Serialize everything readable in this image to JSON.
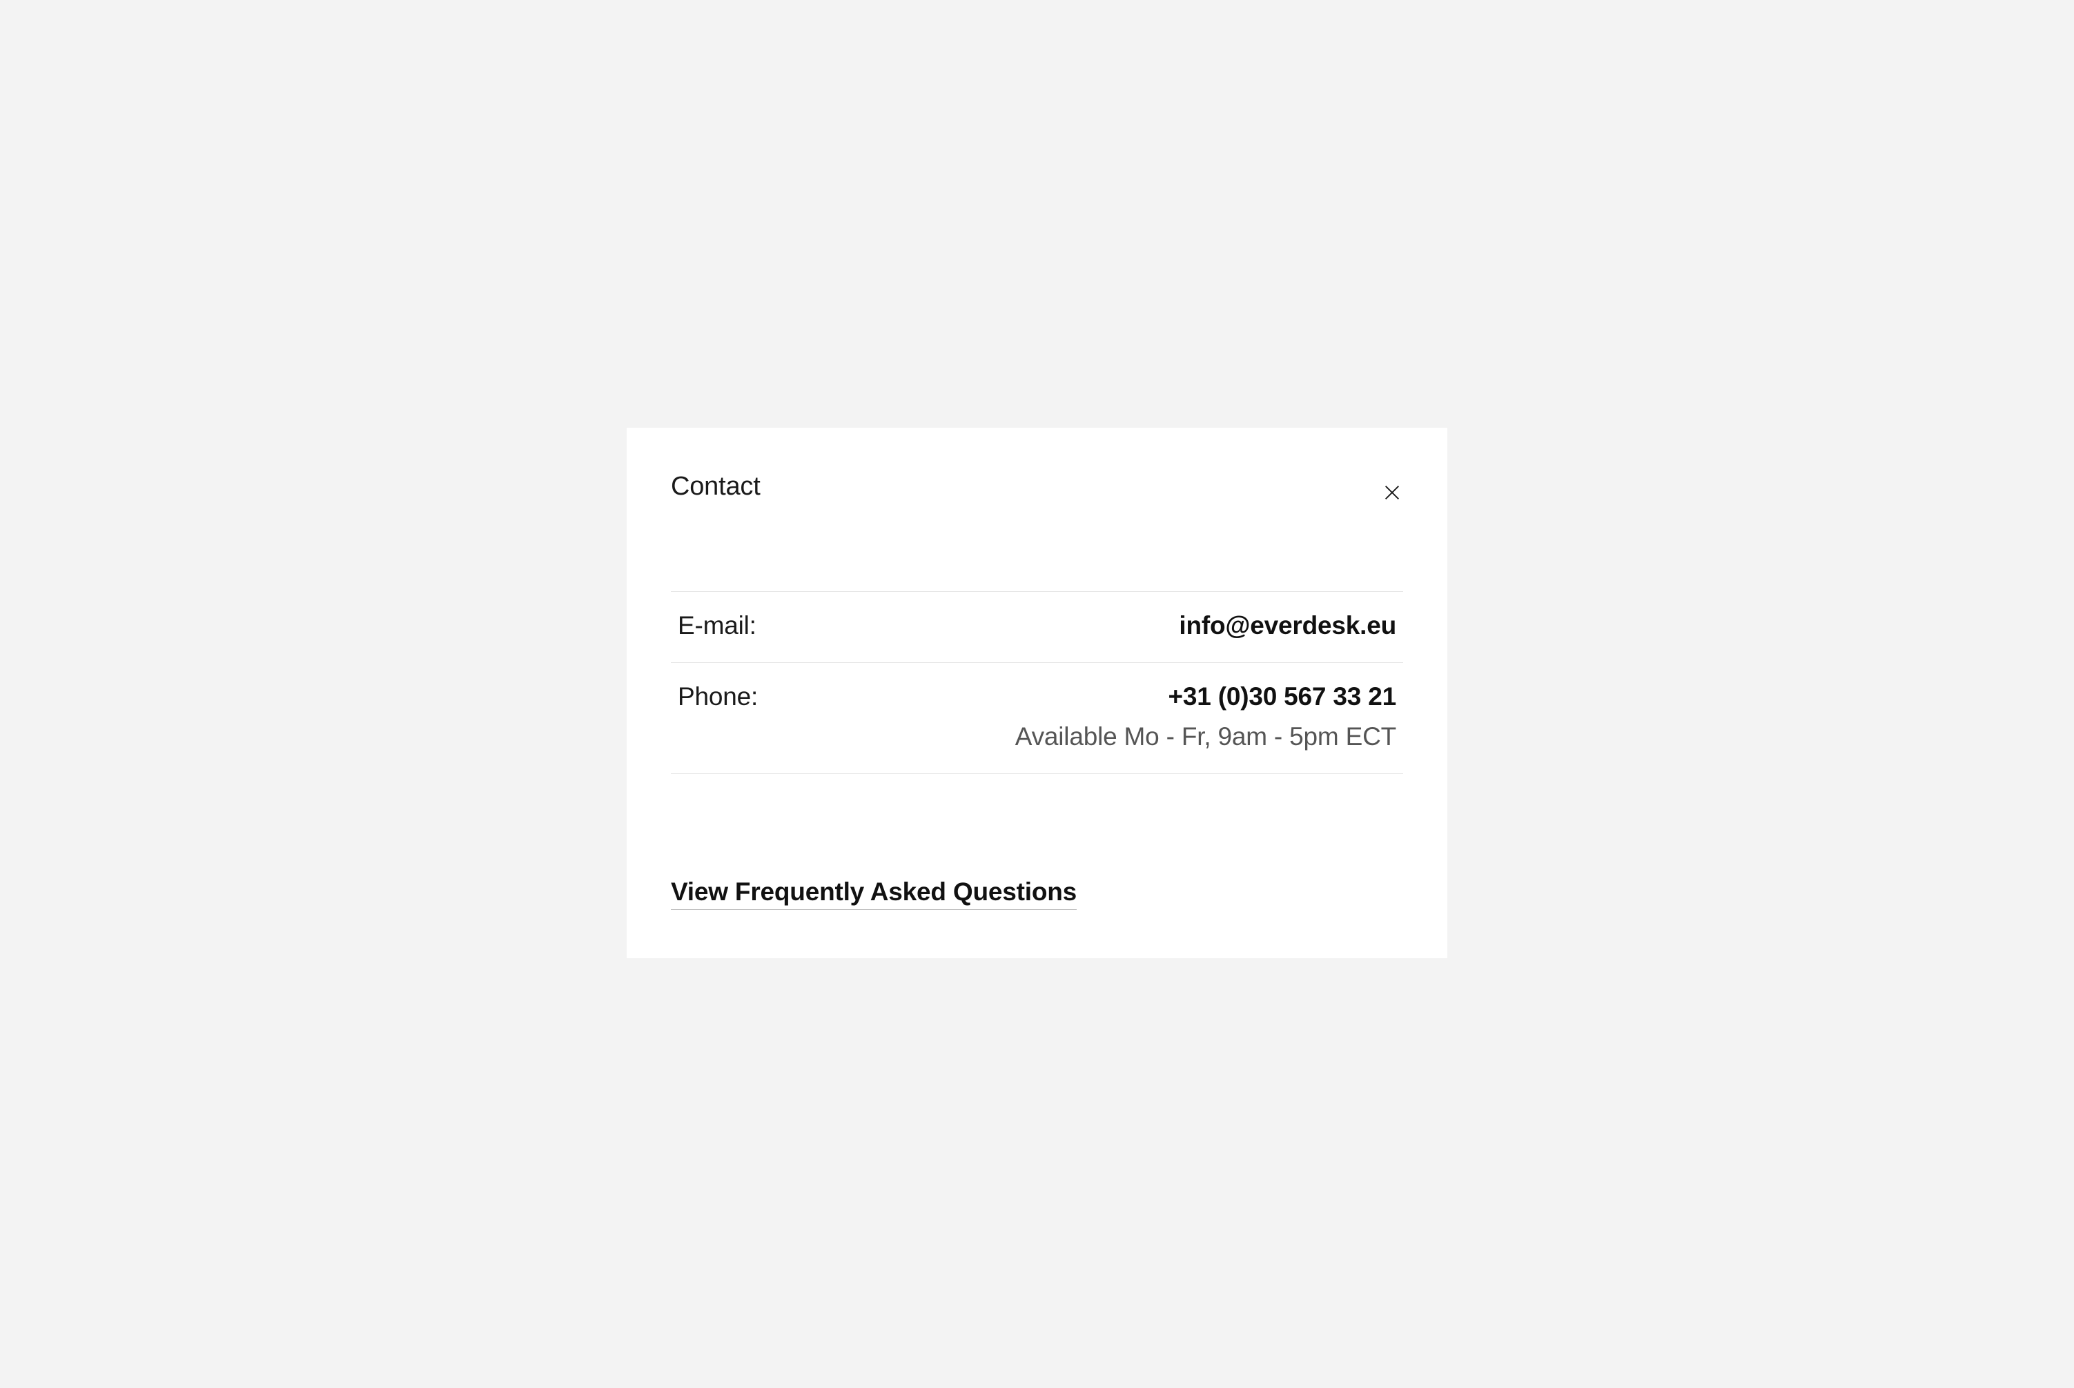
{
  "modal": {
    "title": "Contact",
    "email": {
      "label": "E-mail:",
      "value": "info@everdesk.eu"
    },
    "phone": {
      "label": "Phone:",
      "value": "+31 (0)30 567 33 21",
      "availability": "Available Mo - Fr, 9am - 5pm ECT"
    },
    "faq_link_label": "View Frequently Asked Questions"
  }
}
